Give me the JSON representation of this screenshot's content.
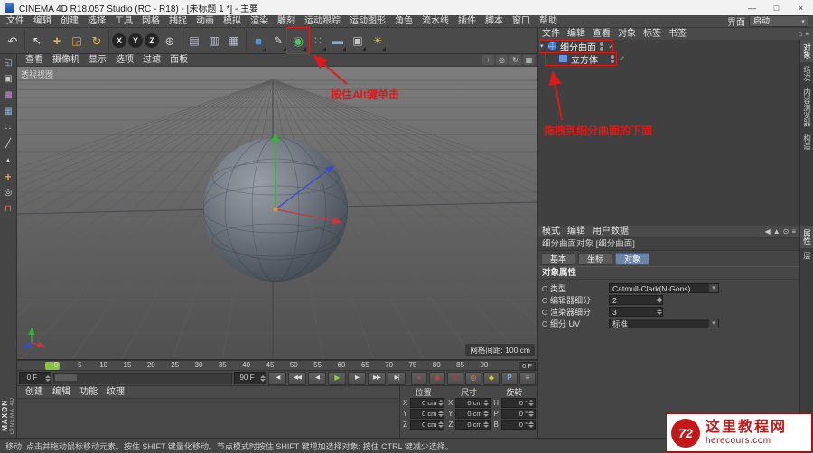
{
  "window": {
    "title": "CINEMA 4D R18.057 Studio (RC - R18) - [未标题 1 *] - 主要",
    "controls": {
      "minimize": "—",
      "maximize": "□",
      "close": "×"
    }
  },
  "icons": {
    "check": "✓",
    "expand": "▾",
    "dropdown_arrow": "▾"
  },
  "menu_bar": {
    "items": [
      "文件",
      "编辑",
      "创建",
      "选择",
      "工具",
      "网格",
      "捕捉",
      "动画",
      "模拟",
      "渲染",
      "雕刻",
      "运动跟踪",
      "运动图形",
      "角色",
      "流水线",
      "插件",
      "脚本",
      "窗口",
      "帮助"
    ],
    "interface_label": "界面",
    "interface_value": "启动"
  },
  "toolbar": {
    "groups": [
      {
        "icons": [
          {
            "name": "undo-icon",
            "glyph": "↶",
            "css": "color:#d8d8d8;font-size:13px"
          }
        ]
      },
      {
        "icons": [
          {
            "name": "live-selection-icon",
            "glyph": "↖",
            "css": "color:#e8e8e8"
          },
          {
            "name": "move-tool-icon",
            "glyph": "+",
            "css": "color:#e6b13f;font-size:15px;font-weight:bold"
          },
          {
            "name": "scale-tool-icon",
            "glyph": "◲",
            "css": "color:#e6b13f;font-size:12px"
          },
          {
            "name": "rotate-tool-icon",
            "glyph": "↻",
            "css": "color:#e6b13f;font-size:13px"
          }
        ]
      },
      {
        "icons": [
          {
            "name": "lock-x-axis-button",
            "glyph": "X",
            "css": "color:#f2f2f2;background:#252525;border-radius:50%;font-size:9px;font-weight:bold;width:16px;height:16px"
          },
          {
            "name": "lock-y-axis-button",
            "glyph": "Y",
            "css": "color:#f2f2f2;background:#252525;border-radius:50%;font-size:9px;font-weight:bold;width:16px;height:16px"
          },
          {
            "name": "lock-z-axis-button",
            "glyph": "Z",
            "css": "color:#f2f2f2;background:#252525;border-radius:50%;font-size:9px;font-weight:bold;width:16px;height:16px"
          },
          {
            "name": "coordinate-system-icon",
            "glyph": "⊕",
            "css": "color:#c8c8c8;font-size:13px"
          }
        ]
      },
      {
        "icons": [
          {
            "name": "render-view-icon",
            "glyph": "▤",
            "css": "color:#b8c4d8;font-size:12px"
          },
          {
            "name": "render-picture-viewer-icon",
            "glyph": "▥",
            "css": "color:#b8c4d8;font-size:12px"
          },
          {
            "name": "render-settings-icon",
            "glyph": "▦",
            "css": "color:#b8c4d8;font-size:12px"
          }
        ]
      },
      {
        "icons": [
          {
            "name": "add-cube-icon",
            "glyph": "■",
            "css": "color:#5b8dd9;font-size:13px",
            "corner": true
          },
          {
            "name": "pen-spline-icon",
            "glyph": "✎",
            "css": "color:#d8d8d8;font-size:12px",
            "corner": true
          },
          {
            "name": "subdivision-surface-icon",
            "glyph": "◉",
            "css": "color:#55c06a;font-size:14px",
            "corner": true,
            "highlight": true
          },
          {
            "name": "cloner-icon",
            "glyph": "∷",
            "css": "color:#55c06a;font-size:12px",
            "corner": true
          },
          {
            "name": "floor-icon",
            "glyph": "▬",
            "css": "color:#8fa8c8;font-size:12px",
            "corner": true
          },
          {
            "name": "camera-icon",
            "glyph": "▣",
            "css": "color:#c8c8c8;font-size:12px",
            "corner": true
          },
          {
            "name": "light-icon",
            "glyph": "☀",
            "css": "color:#e0cc50;font-size:12px",
            "corner": true
          }
        ]
      }
    ]
  },
  "sidebar": {
    "icons": [
      {
        "name": "make-editable-icon",
        "glyph": "◱",
        "css": "color:#a8c0e0"
      },
      {
        "name": "model-mode-icon",
        "glyph": "▣",
        "css": "color:#c8c8c8"
      },
      {
        "name": "texture-mode-icon",
        "glyph": "▩",
        "css": "color:#c090d0"
      },
      {
        "name": "workplane-icon",
        "glyph": "▦",
        "css": "color:#90b0d0"
      },
      {
        "name": "points-mode-icon",
        "glyph": "∷",
        "css": "color:#d8d8d8"
      },
      {
        "name": "edges-mode-icon",
        "glyph": "╱",
        "css": "color:#d8d8d8"
      },
      {
        "name": "polygons-mode-icon",
        "glyph": "▲",
        "css": "color:#d8d8d8;font-size:8px"
      },
      {
        "name": "enable-axis-icon",
        "glyph": "+",
        "css": "color:#e0a840;font-weight:bold;font-size:12px"
      },
      {
        "name": "viewport-solo-icon",
        "glyph": "◎",
        "css": "color:#d8d8d8"
      },
      {
        "name": "snap-icon",
        "glyph": "⊓",
        "css": "color:#d87060"
      }
    ],
    "brand_top": "MAXON",
    "brand_bottom": "CINEMA 4D"
  },
  "viewport": {
    "menus": [
      "查看",
      "摄像机",
      "显示",
      "选项",
      "过滤",
      "面板"
    ],
    "corner_icons": [
      {
        "name": "pan-view-icon",
        "glyph": "+"
      },
      {
        "name": "zoom-view-icon",
        "glyph": "◎"
      },
      {
        "name": "orbit-view-icon",
        "glyph": "↻"
      },
      {
        "name": "toggle-view-icon",
        "glyph": "▦"
      }
    ],
    "view_label": "透视视图",
    "grid_info": "网格间距: 100 cm"
  },
  "timeline": {
    "ticks": [
      "0",
      "5",
      "10",
      "15",
      "20",
      "25",
      "30",
      "35",
      "40",
      "45",
      "50",
      "55",
      "60",
      "65",
      "70",
      "75",
      "80",
      "85",
      "90"
    ],
    "current": "0 F",
    "end": "90 F",
    "playback": [
      {
        "name": "goto-start-button",
        "glyph": "|◀"
      },
      {
        "name": "prev-key-button",
        "glyph": "◀◀"
      },
      {
        "name": "prev-frame-button",
        "glyph": "◀"
      },
      {
        "name": "play-button",
        "glyph": "▶",
        "css": "color:#8ad04a;font-size:8px"
      },
      {
        "name": "next-frame-button",
        "glyph": "▶"
      },
      {
        "name": "next-key-button",
        "glyph": "▶▶"
      },
      {
        "name": "goto-end-button",
        "glyph": "▶|"
      }
    ],
    "record": [
      {
        "name": "record-objects-button",
        "glyph": "●",
        "css": "color:#cc3c3c"
      },
      {
        "name": "autokey-button",
        "glyph": "◉",
        "css": "color:#cc3c3c"
      },
      {
        "name": "record-position-button",
        "glyph": "⊙",
        "css": "color:#cc3c3c"
      },
      {
        "name": "record-scale-button",
        "glyph": "◎",
        "css": "color:#d88a3a"
      },
      {
        "name": "record-rotation-button",
        "glyph": "◆",
        "css": "color:#d8c23a"
      },
      {
        "name": "record-parameter-button",
        "glyph": "P",
        "css": "color:#7aa8e0;font-weight:bold"
      },
      {
        "name": "record-p la-button",
        "glyph": "≡",
        "css": "color:#bbbbbb"
      }
    ]
  },
  "material_manager": {
    "menus": [
      "创建",
      "编辑",
      "功能",
      "纹理"
    ]
  },
  "coordinates": {
    "groups": [
      {
        "title": "位置",
        "rows": [
          {
            "axis": "X",
            "value": "0 cm"
          },
          {
            "axis": "Y",
            "value": "0 cm"
          },
          {
            "axis": "Z",
            "value": "0 cm"
          }
        ]
      },
      {
        "title": "尺寸",
        "rows": [
          {
            "axis": "X",
            "value": "0 cm"
          },
          {
            "axis": "Y",
            "value": "0 cm"
          },
          {
            "axis": "Z",
            "value": "0 cm"
          }
        ]
      },
      {
        "title": "旋转",
        "rows": [
          {
            "axis": "H",
            "value": "0 °"
          },
          {
            "axis": "P",
            "value": "0 °"
          },
          {
            "axis": "B",
            "value": "0 °"
          }
        ]
      }
    ]
  },
  "status_bar": {
    "text": "移动: 点击并拖动鼠标移动元素。按住 SHIFT 键量化移动。节点模式时按住 SHIFT 键增加选择对象; 按住 CTRL 键减少选择。"
  },
  "object_manager": {
    "menus": [
      "文件",
      "编辑",
      "查看",
      "对象",
      "标签",
      "书签"
    ],
    "corner_icons": [
      {
        "name": "om-path-icon",
        "glyph": "⌂"
      },
      {
        "name": "om-filter-icon",
        "glyph": "≡"
      }
    ],
    "objects": [
      {
        "name": "细分曲面",
        "icon": "subdiv",
        "expand": true,
        "child": false
      },
      {
        "name": "立方体",
        "icon": "cube",
        "expand": false,
        "child": true
      }
    ],
    "side_tabs": [
      {
        "label": "对象",
        "active": true
      },
      {
        "label": "场次"
      },
      {
        "label": "内容浏览器"
      },
      {
        "label": "构造"
      }
    ]
  },
  "attribute_manager": {
    "menus": [
      "模式",
      "编辑",
      "用户数据"
    ],
    "corner_icons": [
      {
        "name": "am-back-icon",
        "glyph": "◀"
      },
      {
        "name": "am-up-icon",
        "glyph": "▲"
      },
      {
        "name": "am-lock-icon",
        "glyph": "⊙"
      },
      {
        "name": "am-menu-icon",
        "glyph": "≡"
      }
    ],
    "title": "细分曲面对象 [细分曲面]",
    "tabs": [
      {
        "label": "基本"
      },
      {
        "label": "坐标"
      },
      {
        "label": "对象",
        "active": true
      }
    ],
    "section": "对象属性",
    "properties": [
      {
        "label": "类型",
        "value": "Catmull-Clark(N-Gons)",
        "is_dropdown": true
      },
      {
        "label": "编辑器细分",
        "value": "2",
        "is_dropdown": false
      },
      {
        "label": "渲染器细分",
        "value": "3",
        "is_dropdown": false
      },
      {
        "label": "细分 UV",
        "value": "标准",
        "is_dropdown": true
      }
    ],
    "side_tabs": [
      {
        "label": "属性",
        "active": true
      },
      {
        "label": "层"
      }
    ]
  },
  "annotations": {
    "alt_click": "按住Alt键单击",
    "drag_below": "拖拽到细分曲面的下面"
  },
  "watermark": {
    "logo": "72",
    "name": "这里教程网",
    "url": "herecours.com"
  }
}
